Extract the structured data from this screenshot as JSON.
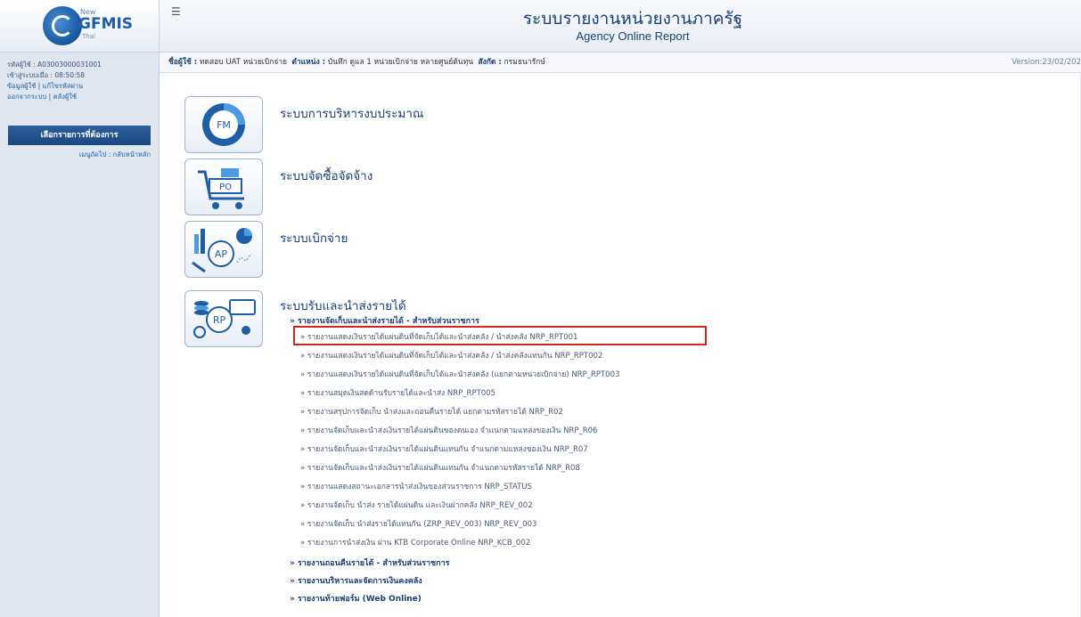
{
  "header": {
    "logo_new": "New",
    "logo_text": "GFMIS",
    "logo_sub": "Thai",
    "menu_toggle": "☰",
    "title_th": "ระบบรายงานหน่วยงานภาครัฐ",
    "title_en": "Agency Online Report"
  },
  "sidebar": {
    "user_line1": "รหัสผู้ใช้ : A03003000031001",
    "user_line2": "เข้าสู่ระบบเมื่อ : 08:50:58",
    "link_line1_a": "ข้อมูลผู้ใช้",
    "link_line1_b": "แก้ไขรหัสผ่าน",
    "link_line2_a": "ออกจากระบบ",
    "link_line2_b": "คลังผู้ใช้",
    "select_label": "เลือกรายการที่ต้องการ",
    "nav_label": "เมนูถัดไป : กลับหน้าหลัก"
  },
  "infobar": {
    "user_label": "ชื่อผู้ใช้ :",
    "user_value": "ทดสอบ UAT หน่วยเบิกจ่าย",
    "position_label": "ตำแหน่ง :",
    "position_value": "บันทึก ดูแล 1 หน่วยเบิกจ่าย หลายศูนย์ต้นทุน",
    "dept_label": "สังกัด :",
    "dept_value": "กรมธนารักษ์",
    "version": "Version:23/02/202"
  },
  "systems": [
    {
      "icon_text": "FM",
      "title": "ระบบการบริหารงบประมาณ"
    },
    {
      "icon_text": "PO",
      "title": "ระบบจัดซื้อจัดจ้าง"
    },
    {
      "icon_text": "AP",
      "title": "ระบบเบิกจ่าย"
    },
    {
      "icon_text": "RP",
      "title": "ระบบรับและนำส่งรายได้"
    }
  ],
  "rp": {
    "group1": "» รายงานจัดเก็บและนำส่งรายได้ - สำหรับส่วนราชการ",
    "reports": [
      "» รายงานแสดงเงินรายได้แผ่นดินที่จัดเก็บได้และนำส่งคลัง / นำส่งคลัง NRP_RPT001",
      "» รายงานแสดงเงินรายได้แผ่นดินที่จัดเก็บได้และนำส่งคลัง / นำส่งคลังแทนกัน NRP_RPT002",
      "» รายงานแสดงเงินรายได้แผ่นดินที่จัดเก็บได้และนำส่งคลัง (แยกตามหน่วยเบิกจ่าย) NRP_RPT003",
      "» รายงานสมุดเงินสดด้านรับรายได้และนำส่ง NRP_RPT005",
      "» รายงานสรุปการจัดเก็บ นำส่งและถอนคืนรายได้ แยกตามรหัสรายได้ NRP_R02",
      "» รายงานจัดเก็บและนำส่งเงินรายได้แผ่นดินของตนเอง จำแนกตามแหล่งของเงิน NRP_R06",
      "» รายงานจัดเก็บและนำส่งเงินรายได้แผ่นดินแทนกัน จำแนกตามแหล่งของเงิน NRP_R07",
      "» รายงานจัดเก็บและนำส่งเงินรายได้แผ่นดินแทนกัน จำแนกตามรหัสรายได้ NRP_R08",
      "» รายงานแสดงสถานะเอกสารนำส่งเงินของส่วนราชการ NRP_STATUS",
      "» รายงานจัดเก็บ นำส่ง รายได้แผ่นดิน และเงินฝากคลัง NRP_REV_002",
      "» รายงานจัดเก็บ นำส่งรายได้แทนกัน (ZRP_REV_003) NRP_REV_003",
      "» รายงานการนำส่งเงิน ผ่าน KTB Corporate Online NRP_KCB_002"
    ],
    "group2": "» รายงานถอนคืนรายได้ - สำหรับส่วนราชการ",
    "group3": "» รายงานบริหารและจัดการเงินคงคลัง",
    "group4": "» รายงานท้ายฟอร์ม (Web Online)"
  },
  "colors": {
    "accent": "#1c3f73",
    "highlight": "#d9251c",
    "sidebar_bg": "#dfe6f0"
  }
}
